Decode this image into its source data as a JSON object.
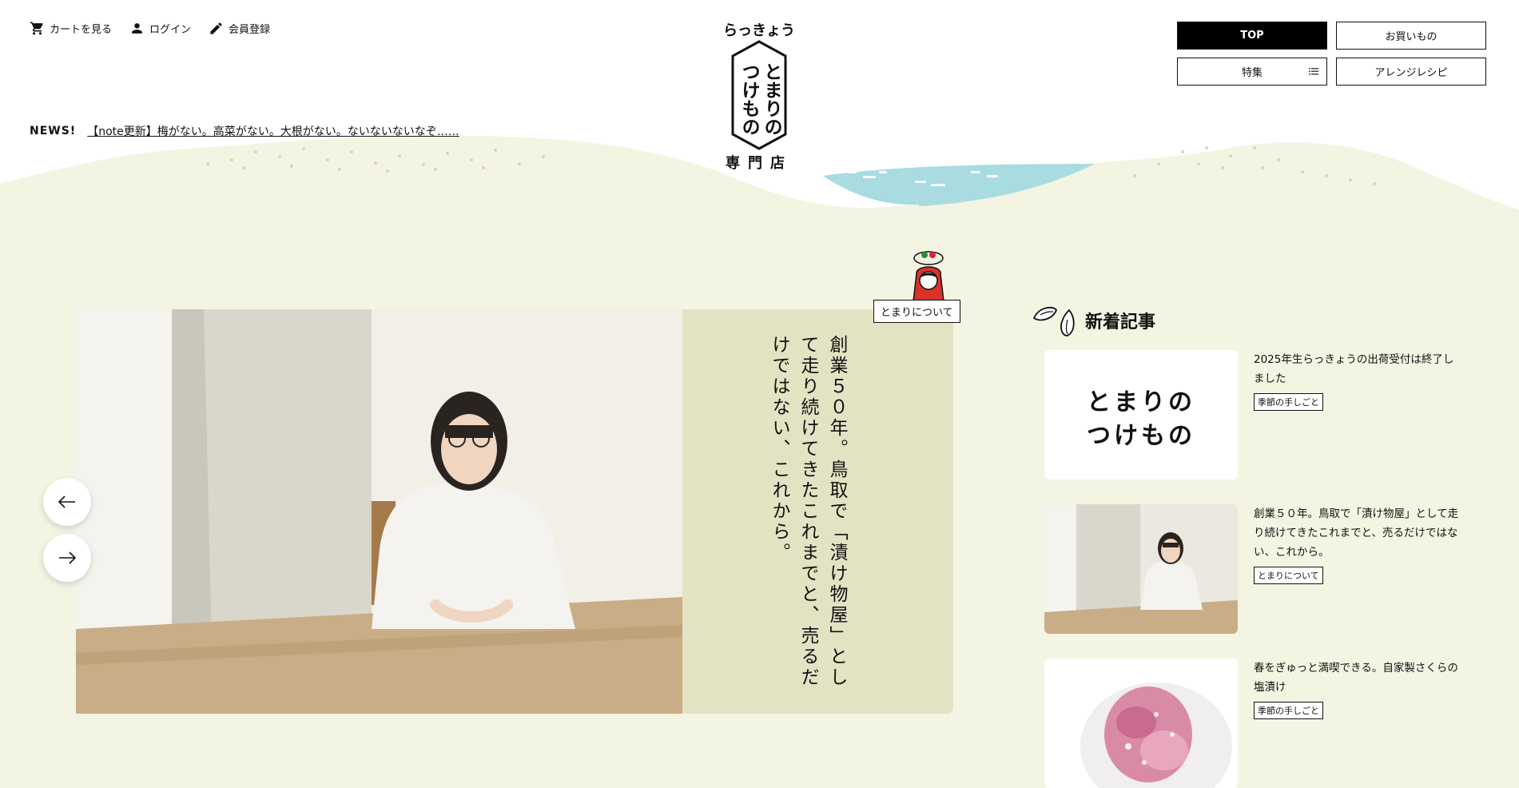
{
  "utility": {
    "cart_label": "カートを見る",
    "login_label": "ログイン",
    "register_label": "会員登録"
  },
  "news": {
    "label": "NEWS!",
    "headline": "【note更新】梅がない。高菜がない。大根がない。ないないないなぞ……"
  },
  "logo": {
    "top_text": "らっきょう",
    "main_text_line1": "とまりの",
    "main_text_line2": "つけもの",
    "bottom_text": "専門店"
  },
  "nav": {
    "top": "TOP",
    "shop": "お買いもの",
    "features": "特集",
    "recipes": "アレンジレシピ"
  },
  "hero": {
    "headline": "創業５０年。鳥取で「漬け物屋」として走り続けてきたこれまでと、売るだけではない、これから。",
    "about_tag": "とまりについて"
  },
  "latest": {
    "title": "新着記事",
    "articles": [
      {
        "title": "2025年生らっきょうの出荷受付は終了しました",
        "tag": "季節の手しごと",
        "thumb_text_line1": "とまりの",
        "thumb_text_line2": "つけもの"
      },
      {
        "title": "創業５０年。鳥取で「漬け物屋」として走り続けてきたこれまでと、売るだけではない、これから。",
        "tag": "とまりについて"
      },
      {
        "title": "春をぎゅっと満喫できる。自家製さくらの塩漬け",
        "tag": "季節の手しごと"
      }
    ]
  },
  "colors": {
    "background": "#f3f4e2",
    "hero_panel": "#e3e3c4",
    "river": "#a8dce0",
    "dots": "#d6d8b4",
    "nav_active": "#000000"
  },
  "icons": [
    "cart-icon",
    "person-icon",
    "pencil-icon",
    "menu-lines-icon",
    "arrow-left-icon",
    "arrow-right-icon",
    "rakkyo-icon"
  ]
}
